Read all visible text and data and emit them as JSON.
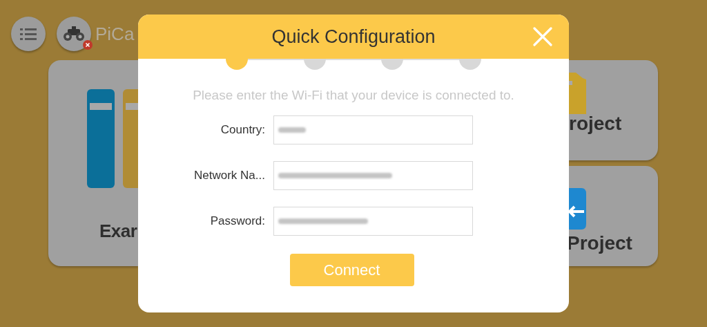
{
  "app_bar": {
    "title": "PiCa",
    "connection_error": true
  },
  "background_cards": [
    {
      "kind": "examples",
      "label": "Exar"
    },
    {
      "kind": "new-project",
      "label": "roject"
    },
    {
      "kind": "import-project",
      "label": "Project"
    }
  ],
  "dialog": {
    "title": "Quick Configuration",
    "steps": [
      {
        "selected": true
      },
      {
        "selected": false
      },
      {
        "selected": false
      },
      {
        "selected": false
      }
    ],
    "instruction": "Please enter the Wi-Fi that your device is connected to.",
    "fields": [
      {
        "label": "Country:",
        "obscured": true
      },
      {
        "label": "Network Na...",
        "obscured": true
      },
      {
        "label": "Password:",
        "obscured": true
      }
    ],
    "button": "Connect"
  }
}
